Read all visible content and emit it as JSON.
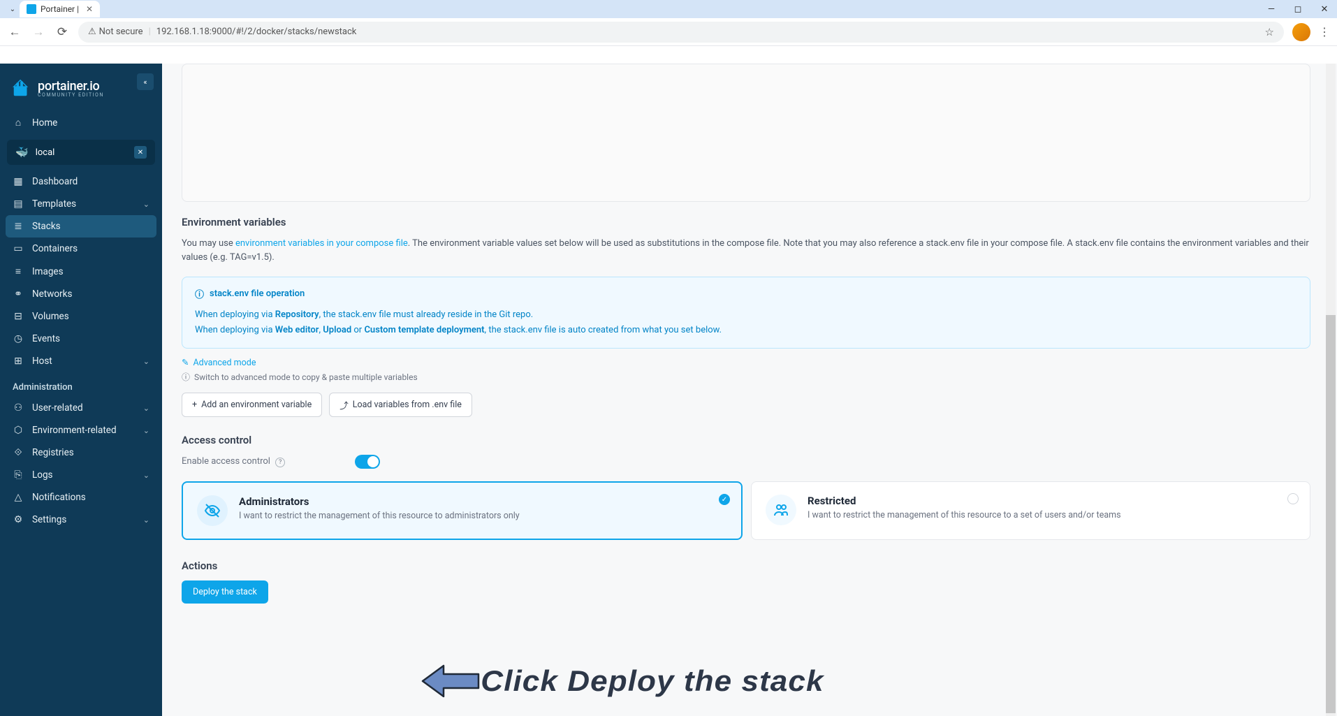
{
  "browser": {
    "tab_title": "Portainer |",
    "url": "192.168.1.18:9000/#!/2/docker/stacks/newstack",
    "security_label": "Not secure"
  },
  "sidebar": {
    "brand": "portainer.io",
    "brand_sub": "COMMUNITY EDITION",
    "home": "Home",
    "env_name": "local",
    "items": [
      {
        "label": "Dashboard",
        "icon": "▦"
      },
      {
        "label": "Templates",
        "icon": "▤",
        "chevron": true
      },
      {
        "label": "Stacks",
        "icon": "≣",
        "active": true
      },
      {
        "label": "Containers",
        "icon": "▭"
      },
      {
        "label": "Images",
        "icon": "≡"
      },
      {
        "label": "Networks",
        "icon": "⚭"
      },
      {
        "label": "Volumes",
        "icon": "⊟"
      },
      {
        "label": "Events",
        "icon": "◷"
      },
      {
        "label": "Host",
        "icon": "⊞",
        "chevron": true
      }
    ],
    "admin_label": "Administration",
    "admin_items": [
      {
        "label": "User-related",
        "icon": "⚇",
        "chevron": true
      },
      {
        "label": "Environment-related",
        "icon": "⬡",
        "chevron": true
      },
      {
        "label": "Registries",
        "icon": "⟐"
      },
      {
        "label": "Logs",
        "icon": "⎘",
        "chevron": true
      },
      {
        "label": "Notifications",
        "icon": "△"
      },
      {
        "label": "Settings",
        "icon": "⚙",
        "chevron": true
      }
    ]
  },
  "content": {
    "env_title": "Environment variables",
    "env_help_pre": "You may use ",
    "env_help_link": "environment variables in your compose file",
    "env_help_post": ". The environment variable values set below will be used as substitutions in the compose file. Note that you may also reference a stack.env file in your compose file. A stack.env file contains the environment variables and their values (e.g. TAG=v1.5).",
    "info_title": "stack.env file operation",
    "info_line1_pre": "When deploying via ",
    "info_line1_bold": "Repository",
    "info_line1_post": ", the stack.env file must already reside in the Git repo.",
    "info_line2_pre": "When deploying via ",
    "info_line2_b1": "Web editor",
    "info_line2_sep1": ", ",
    "info_line2_b2": "Upload",
    "info_line2_sep2": " or ",
    "info_line2_b3": "Custom template deployment",
    "info_line2_post": ", the stack.env file is auto created from what you set below.",
    "advanced_mode": "Advanced mode",
    "advanced_hint": "Switch to advanced mode to copy & paste multiple variables",
    "btn_add": "Add an environment variable",
    "btn_load": "Load variables from .env file",
    "access_title": "Access control",
    "access_label": "Enable access control",
    "card_admin_title": "Administrators",
    "card_admin_desc": "I want to restrict the management of this resource to administrators only",
    "card_restricted_title": "Restricted",
    "card_restricted_desc": "I want to restrict the management of this resource to a set of users and/or teams",
    "actions_title": "Actions",
    "deploy_label": "Deploy the stack",
    "annotation": "Click Deploy the stack"
  }
}
